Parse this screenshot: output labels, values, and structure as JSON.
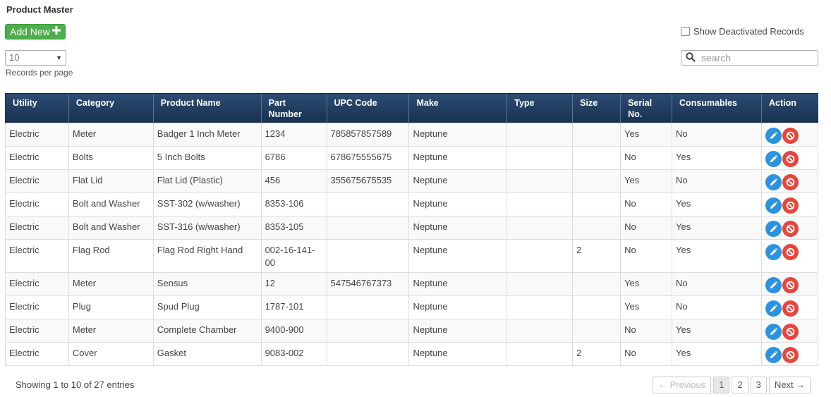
{
  "page": {
    "title": "Product Master"
  },
  "toolbar": {
    "add_label": "Add New",
    "add_icon": "plus-icon"
  },
  "page_size": {
    "value": "10",
    "label": "Records per page"
  },
  "filters": {
    "show_deactivated_label": "Show Deactivated Records",
    "show_deactivated_checked": false
  },
  "search": {
    "placeholder": "search",
    "icon": "search-icon"
  },
  "table": {
    "columns": [
      "Utility",
      "Category",
      "Product Name",
      "Part Number",
      "UPC Code",
      "Make",
      "Type",
      "Size",
      "Serial No.",
      "Consumables",
      "Action"
    ],
    "rows": [
      [
        "Electric",
        "Meter",
        "Badger 1 Inch Meter",
        "1234",
        "785857857589",
        "Neptune",
        "",
        "",
        "Yes",
        "No"
      ],
      [
        "Electric",
        "Bolts",
        "5 Inch Bolts",
        "6786",
        "678675555675",
        "Neptune",
        "",
        "",
        "No",
        "Yes"
      ],
      [
        "Electric",
        "Flat Lid",
        "Flat Lid (Plastic)",
        "456",
        "355675675535",
        "Neptune",
        "",
        "",
        "Yes",
        "No"
      ],
      [
        "Electric",
        "Bolt and Washer",
        "SST-302 (w/washer)",
        "8353-106",
        "",
        "Neptune",
        "",
        "",
        "No",
        "Yes"
      ],
      [
        "Electric",
        "Bolt and Washer",
        "SST-316 (w/washer)",
        "8353-105",
        "",
        "Neptune",
        "",
        "",
        "No",
        "Yes"
      ],
      [
        "Electric",
        "Flag Rod",
        "Flag Rod Right Hand",
        "002-16-141-00",
        "",
        "Neptune",
        "",
        "2",
        "No",
        "Yes"
      ],
      [
        "Electric",
        "Meter",
        "Sensus",
        "12",
        "547546767373",
        "Neptune",
        "",
        "",
        "Yes",
        "No"
      ],
      [
        "Electric",
        "Plug",
        "Spud Plug",
        "1787-101",
        "",
        "Neptune",
        "",
        "",
        "Yes",
        "No"
      ],
      [
        "Electric",
        "Meter",
        "Complete Chamber",
        "9400-900",
        "",
        "Neptune",
        "",
        "",
        "No",
        "Yes"
      ],
      [
        "Electric",
        "Cover",
        "Gasket",
        "9083-002",
        "",
        "Neptune",
        "",
        "2",
        "No",
        "Yes"
      ]
    ],
    "action_icons": [
      "pencil-icon",
      "ban-icon"
    ]
  },
  "footer": {
    "info": "Showing 1 to 10 of 27 entries"
  },
  "pagination": {
    "previous": "← Previous",
    "pages": [
      "1",
      "2",
      "3"
    ],
    "current": "1",
    "next": "Next →"
  },
  "colors": {
    "add_button": "#4cae4c",
    "header_bg": "#1f3a5f",
    "edit": "#2b93e0",
    "delete": "#e8453c"
  }
}
